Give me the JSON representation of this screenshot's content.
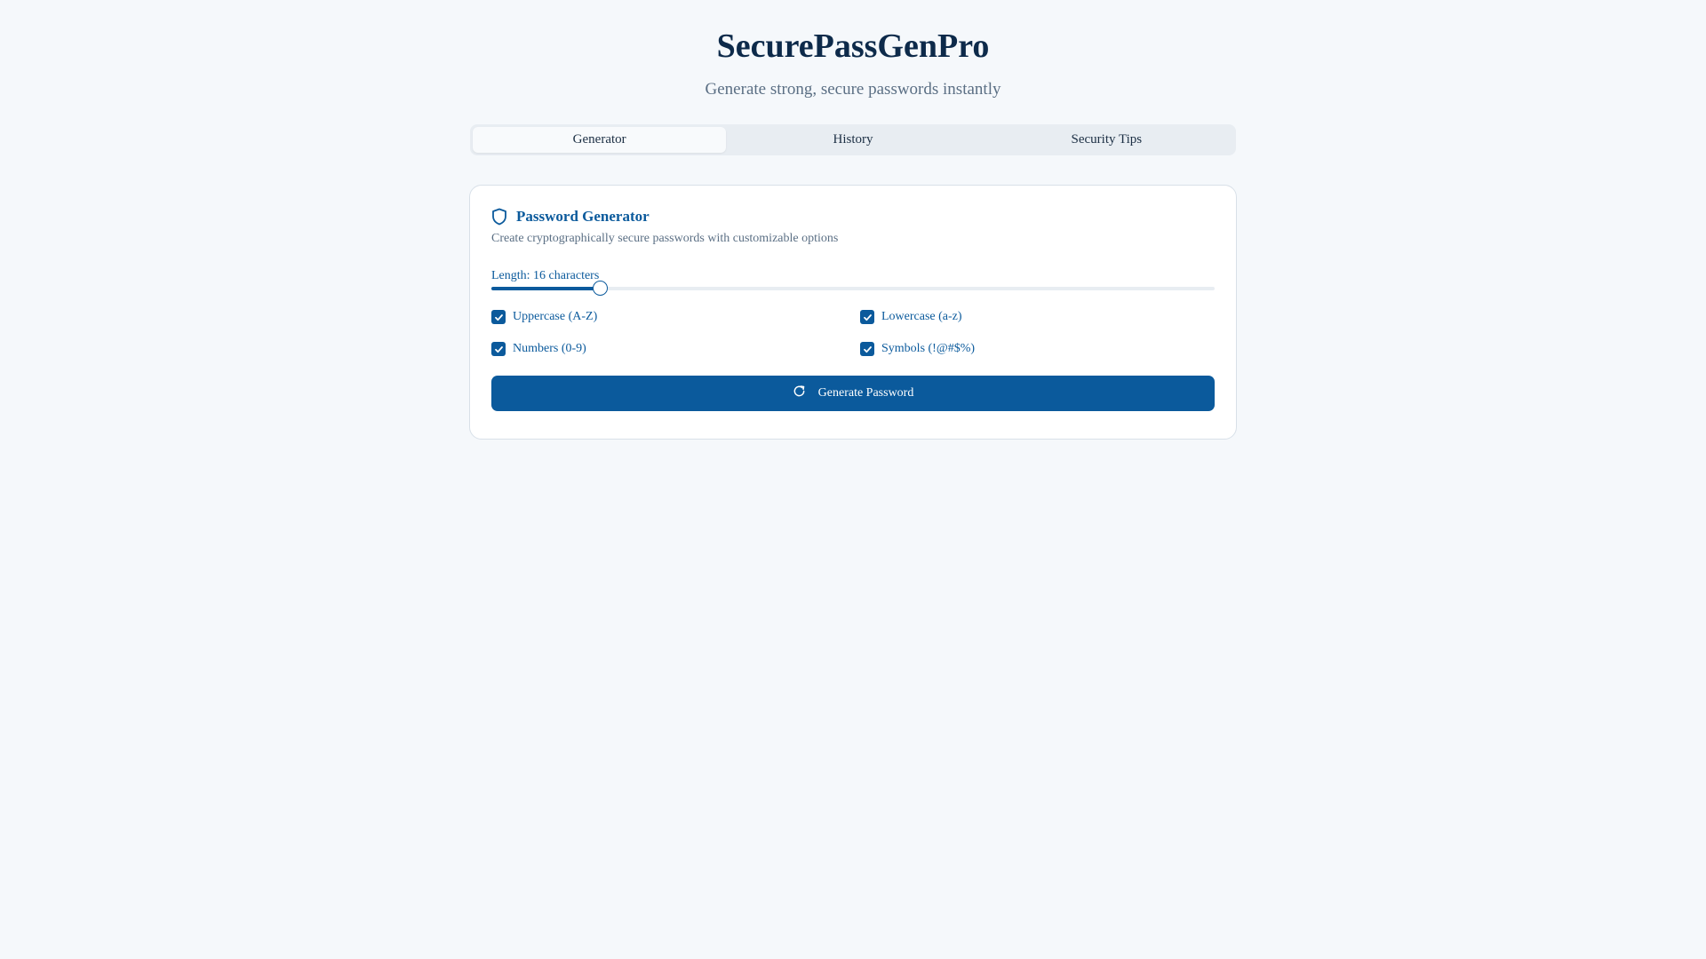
{
  "header": {
    "title": "SecurePassGenPro",
    "subtitle": "Generate strong, secure passwords instantly"
  },
  "tabs": [
    {
      "label": "Generator",
      "active": true
    },
    {
      "label": "History",
      "active": false
    },
    {
      "label": "Security Tips",
      "active": false
    }
  ],
  "generator": {
    "icon": "shield-icon",
    "title": "Password Generator",
    "description": "Create cryptographically secure passwords with customizable options",
    "length_label": "Length: 16 characters",
    "length_value": 16,
    "length_fraction": 0.15,
    "options": [
      {
        "label": "Uppercase (A-Z)",
        "checked": true
      },
      {
        "label": "Lowercase (a-z)",
        "checked": true
      },
      {
        "label": "Numbers (0-9)",
        "checked": true
      },
      {
        "label": "Symbols (!@#$%)",
        "checked": true
      }
    ],
    "generate_label": "Generate Password",
    "generate_icon": "refresh-icon"
  },
  "colors": {
    "accent": "#0b5a9c",
    "title": "#0d2a4a",
    "muted": "#5b6f84",
    "background": "#f5f8fb"
  }
}
